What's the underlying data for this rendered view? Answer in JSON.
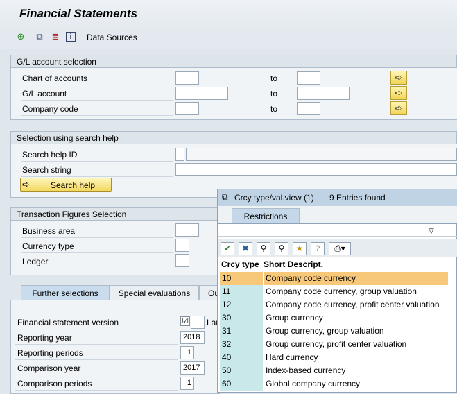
{
  "title": "Financial Statements",
  "toolbar": {
    "data_sources": "Data Sources"
  },
  "gl": {
    "title": "G/L account selection",
    "chart": "Chart of accounts",
    "account": "G/L account",
    "company": "Company code",
    "to": "to"
  },
  "search": {
    "title": "Selection using search help",
    "id": "Search help ID",
    "string": "Search string",
    "button": "Search help"
  },
  "tx": {
    "title": "Transaction Figures Selection",
    "business": "Business area",
    "currency": "Currency type",
    "ledger": "Ledger"
  },
  "tabs": [
    "Further selections",
    "Special evaluations",
    "Ou"
  ],
  "further": {
    "fsv": "Financial statement version",
    "fsv_lang": "Lar",
    "rep_year": "Reporting year",
    "rep_year_val": "2018",
    "rep_periods": "Reporting periods",
    "rep_periods_val": "1",
    "cmp_year": "Comparison year",
    "cmp_year_val": "2017",
    "cmp_periods": "Comparison periods",
    "cmp_periods_val": "1"
  },
  "popup": {
    "title": "Crcy type/val.view (1)",
    "found": "9 Entries found",
    "restrictions": "Restrictions",
    "col1": "Crcy type",
    "col2": "Short Descript.",
    "rows": [
      {
        "code": "10",
        "desc": "Company code currency"
      },
      {
        "code": "11",
        "desc": "Company code currency, group valuation"
      },
      {
        "code": "12",
        "desc": "Company code currency, profit center valuation"
      },
      {
        "code": "30",
        "desc": "Group currency"
      },
      {
        "code": "31",
        "desc": "Group currency, group valuation"
      },
      {
        "code": "32",
        "desc": "Group currency, profit center valuation"
      },
      {
        "code": "40",
        "desc": "Hard currency"
      },
      {
        "code": "50",
        "desc": "Index-based currency"
      },
      {
        "code": "60",
        "desc": "Global company currency"
      }
    ]
  }
}
